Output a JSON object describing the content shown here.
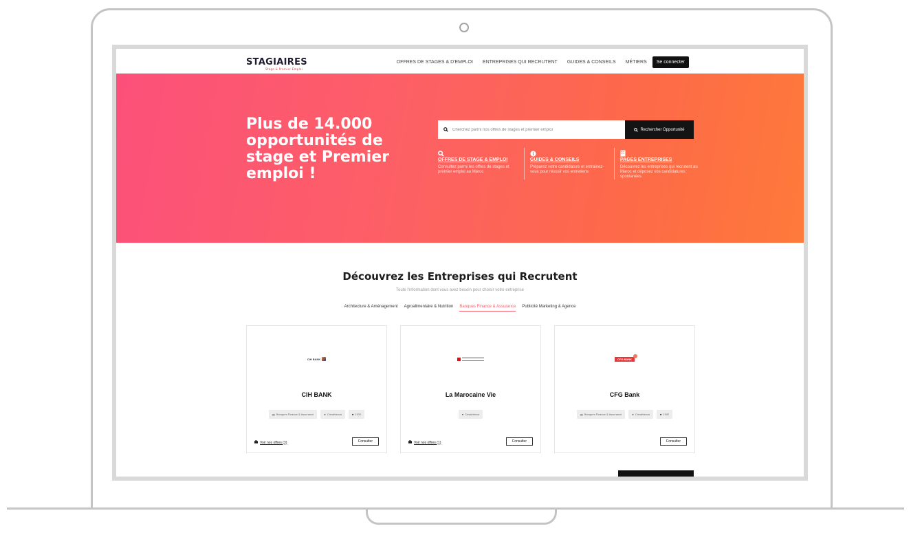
{
  "nav": {
    "logo": "STAGIAIRES",
    "logo_sub": "Stage & Premier Emploi",
    "links": [
      "OFFRES DE STAGES & D'EMPLOI",
      "ENTREPRISES QUI RECRUTENT",
      "GUIDES & CONSEILS",
      "MÉTIERS"
    ],
    "login": "Se connecter"
  },
  "hero": {
    "title": "Plus de 14.000 opportunités de stage et Premier emploi !",
    "search_placeholder": "Cherchez parmi nos offres de stages et premier emploi",
    "search_button": "Rechercher Opportunité",
    "features": [
      {
        "icon": "search-icon",
        "title": "OFFRES DE STAGE & EMPLOI",
        "desc": "Consultez parmi les offres de stages et premier emploi au Maroc"
      },
      {
        "icon": "info-icon",
        "title": "GUIDES & CONSEILS",
        "desc": "Préparez votre candidature et entrainez-vous pour réussir vos entretiens"
      },
      {
        "icon": "building-icon",
        "title": "PAGES ENTREPRISES",
        "desc": "Découvrez les entreprises qui recrutent au Maroc et déposez vos candidatures spontanées"
      }
    ]
  },
  "companies": {
    "title": "Découvrez les Entreprises qui Recrutent",
    "subtitle": "Toute l'information dont vous avez besoin pour choisir votre entreprise",
    "tabs": [
      "Architecture & Aménagement",
      "Agroalimentaire & Nutrition",
      "Banques Finance & Assurance",
      "Publicité Marketing & Agence"
    ],
    "active_tab": "Banques Finance & Assurance",
    "cards": [
      {
        "logo_text": "CIH BANK",
        "name": "CIH BANK",
        "tags": [
          "Banques Finance & Assurance",
          "Casablanca",
          "1920"
        ],
        "offers": "Voir nos offres (3)",
        "consult": "Consulter"
      },
      {
        "logo_text": "",
        "name": "La Marocaine Vie",
        "tags": [
          "Casablanca"
        ],
        "offers": "Voir nos offres (1)",
        "consult": "Consulter"
      },
      {
        "logo_text": "CFG BANK",
        "name": "CFG Bank",
        "tags": [
          "Banques Finance & Assurance",
          "Casablanca",
          "1992"
        ],
        "offers": "",
        "consult": "Consulter"
      }
    ]
  },
  "colors": {
    "accent": "#fd5a6a",
    "hero_start": "#fc507a",
    "hero_end": "#fe7a3a",
    "dark": "#111111"
  }
}
